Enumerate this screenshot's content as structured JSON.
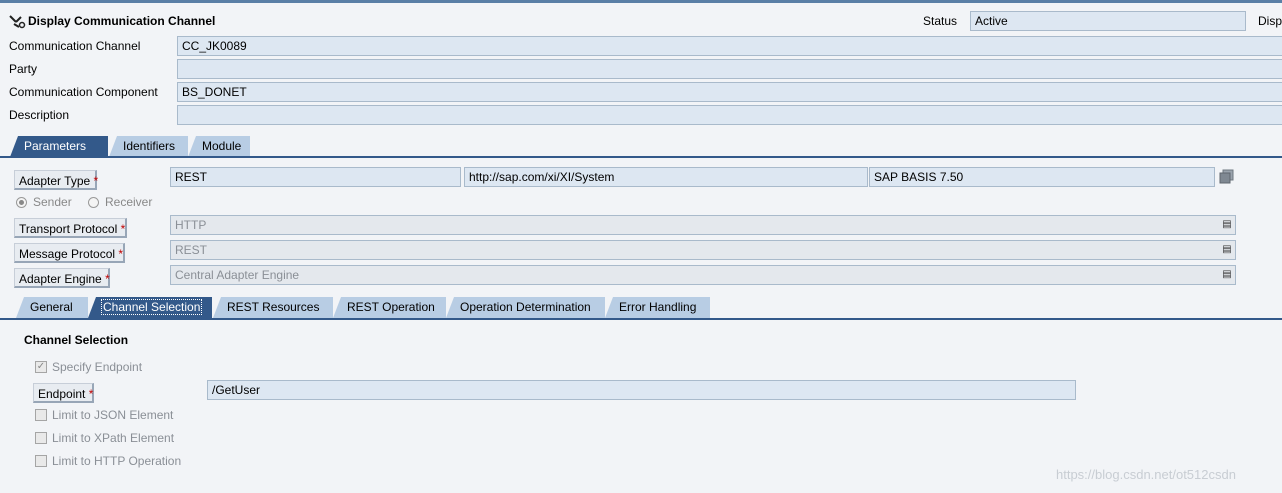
{
  "header": {
    "title": "Display Communication Channel",
    "status_label": "Status",
    "status_value": "Active",
    "disp_label": "Disp"
  },
  "general_fields": {
    "communication_channel_label": "Communication Channel",
    "communication_channel_value": "CC_JK0089",
    "party_label": "Party",
    "party_value": "",
    "communication_component_label": "Communication Component",
    "communication_component_value": "BS_DONET",
    "description_label": "Description",
    "description_value": ""
  },
  "main_tabs": [
    {
      "label": "Parameters",
      "active": true
    },
    {
      "label": "Identifiers",
      "active": false
    },
    {
      "label": "Module",
      "active": false
    }
  ],
  "parameters": {
    "adapter_type_label": "Adapter Type",
    "adapter_type_value": "REST",
    "namespace_value": "http://sap.com/xi/XI/System",
    "software_component_value": "SAP BASIS 7.50",
    "sender_label": "Sender",
    "receiver_label": "Receiver",
    "direction_selected": "Sender",
    "transport_protocol_label": "Transport Protocol",
    "transport_protocol_value": "HTTP",
    "message_protocol_label": "Message Protocol",
    "message_protocol_value": "REST",
    "adapter_engine_label": "Adapter Engine",
    "adapter_engine_value": "Central Adapter Engine",
    "required_mark": "*"
  },
  "sub_tabs": [
    {
      "label": "General",
      "active": false
    },
    {
      "label": "Channel Selection",
      "active": true
    },
    {
      "label": "REST Resources",
      "active": false
    },
    {
      "label": "REST Operation",
      "active": false
    },
    {
      "label": "Operation Determination",
      "active": false
    },
    {
      "label": "Error Handling",
      "active": false
    }
  ],
  "channel_selection": {
    "section_title": "Channel Selection",
    "specify_endpoint_label": "Specify Endpoint",
    "specify_endpoint_checked": true,
    "endpoint_label": "Endpoint",
    "endpoint_value": "/GetUser",
    "limit_json_label": "Limit to JSON Element",
    "limit_json_checked": false,
    "limit_xpath_label": "Limit to XPath Element",
    "limit_xpath_checked": false,
    "limit_http_label": "Limit to HTTP Operation",
    "limit_http_checked": false
  },
  "watermark": "https://blog.csdn.net/ot512csdn",
  "colors": {
    "active_tab": "#33598a",
    "inactive_tab": "#b8cde4",
    "field_bg": "#dde7f2",
    "required": "#c00000"
  }
}
